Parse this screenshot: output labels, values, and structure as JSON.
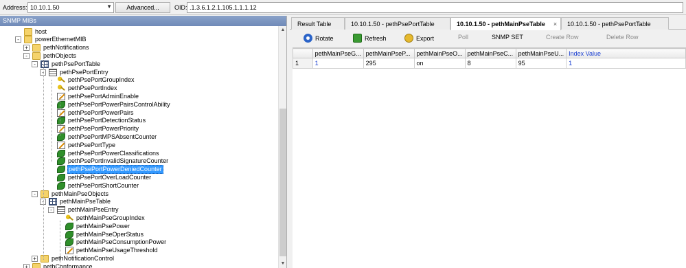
{
  "address": {
    "label": "Address:",
    "value": "10.10.1.50",
    "advanced_label": "Advanced..."
  },
  "oid": {
    "label": "OID:",
    "value": ".1.3.6.1.2.1.105.1.1.1.12"
  },
  "left_panel": {
    "header": "SNMP MIBs"
  },
  "tree": [
    {
      "label": "host",
      "icon": "folder",
      "level": 2,
      "expander": ""
    },
    {
      "label": "powerEthernetMIB",
      "icon": "folder",
      "level": 2,
      "expander": "-"
    },
    {
      "label": "pethNotifications",
      "icon": "folder",
      "level": 3,
      "expander": "+"
    },
    {
      "label": "pethObjects",
      "icon": "folder",
      "level": 3,
      "expander": "-"
    },
    {
      "label": "pethPsePortTable",
      "icon": "table",
      "level": 4,
      "expander": "-"
    },
    {
      "label": "pethPsePortEntry",
      "icon": "entry",
      "level": 5,
      "expander": "-"
    },
    {
      "label": "pethPsePortGroupIndex",
      "icon": "key",
      "level": 6,
      "expander": ""
    },
    {
      "label": "pethPsePortIndex",
      "icon": "key",
      "level": 6,
      "expander": ""
    },
    {
      "label": "pethPsePortAdminEnable",
      "icon": "edit",
      "level": 6,
      "expander": ""
    },
    {
      "label": "pethPsePortPowerPairsControlAbility",
      "icon": "leaf",
      "level": 6,
      "expander": ""
    },
    {
      "label": "pethPsePortPowerPairs",
      "icon": "edit",
      "level": 6,
      "expander": ""
    },
    {
      "label": "pethPsePortDetectionStatus",
      "icon": "leaf",
      "level": 6,
      "expander": ""
    },
    {
      "label": "pethPsePortPowerPriority",
      "icon": "edit",
      "level": 6,
      "expander": ""
    },
    {
      "label": "pethPsePortMPSAbsentCounter",
      "icon": "leaf",
      "level": 6,
      "expander": ""
    },
    {
      "label": "pethPsePortType",
      "icon": "edit",
      "level": 6,
      "expander": ""
    },
    {
      "label": "pethPsePortPowerClassifications",
      "icon": "leaf",
      "level": 6,
      "expander": ""
    },
    {
      "label": "pethPsePortInvalidSignatureCounter",
      "icon": "leaf",
      "level": 6,
      "expander": ""
    },
    {
      "label": "pethPsePortPowerDeniedCounter",
      "icon": "leaf",
      "level": 6,
      "expander": "",
      "selected": true
    },
    {
      "label": "pethPsePortOverLoadCounter",
      "icon": "leaf",
      "level": 6,
      "expander": ""
    },
    {
      "label": "pethPsePortShortCounter",
      "icon": "leaf",
      "level": 6,
      "expander": ""
    },
    {
      "label": "pethMainPseObjects",
      "icon": "folder",
      "level": 4,
      "expander": "-"
    },
    {
      "label": "pethMainPseTable",
      "icon": "table",
      "level": 5,
      "expander": "-"
    },
    {
      "label": "pethMainPseEntry",
      "icon": "entry",
      "level": 6,
      "expander": "-"
    },
    {
      "label": "pethMainPseGroupIndex",
      "icon": "key",
      "level": 7,
      "expander": ""
    },
    {
      "label": "pethMainPsePower",
      "icon": "leaf",
      "level": 7,
      "expander": ""
    },
    {
      "label": "pethMainPseOperStatus",
      "icon": "leaf",
      "level": 7,
      "expander": ""
    },
    {
      "label": "pethMainPseConsumptionPower",
      "icon": "leaf",
      "level": 7,
      "expander": ""
    },
    {
      "label": "pethMainPseUsageThreshold",
      "icon": "edit",
      "level": 7,
      "expander": ""
    },
    {
      "label": "pethNotificationControl",
      "icon": "folder",
      "level": 4,
      "expander": "+"
    },
    {
      "label": "pethConformance",
      "icon": "folder",
      "level": 3,
      "expander": "+"
    }
  ],
  "tabs": [
    {
      "label": "Result Table",
      "active": false,
      "closable": false
    },
    {
      "label": "10.10.1.50 - pethPsePortTable",
      "active": false,
      "closable": false
    },
    {
      "label": "10.10.1.50 - pethMainPseTable",
      "active": true,
      "closable": true,
      "close_glyph": "×"
    },
    {
      "label": "10.10.1.50 - pethPsePortTable",
      "active": false,
      "closable": false
    }
  ],
  "toolbar": {
    "rotate": "Rotate",
    "refresh": "Refresh",
    "export": "Export",
    "poll": "Poll",
    "snmp_set": "SNMP SET",
    "create_row": "Create Row",
    "delete_row": "Delete Row"
  },
  "table": {
    "columns": [
      "pethMainPseG...",
      "pethMainPseP...",
      "pethMainPseO...",
      "pethMainPseC...",
      "pethMainPseU...",
      "Index Value"
    ],
    "rows": [
      {
        "num": "1",
        "cells": [
          "1",
          "295",
          "on",
          "8",
          "95",
          "1"
        ]
      }
    ]
  }
}
